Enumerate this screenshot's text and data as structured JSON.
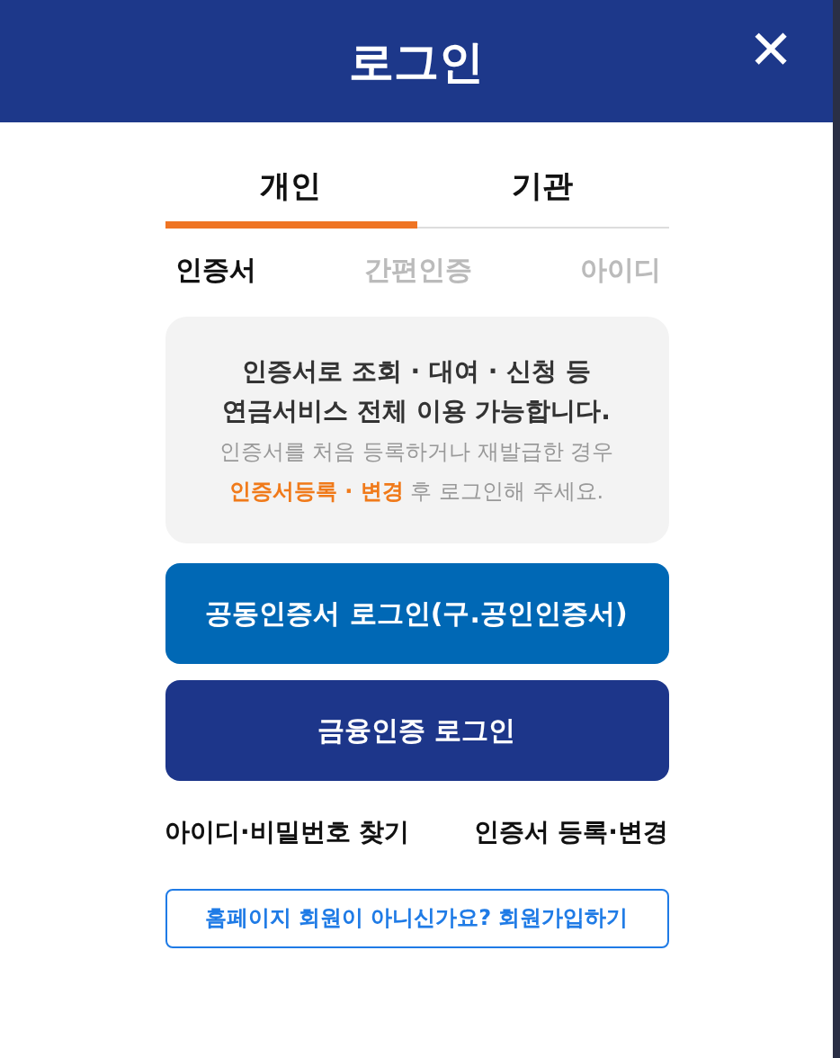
{
  "window": {
    "title": "로그인",
    "close": "✕"
  },
  "tabs": [
    {
      "label": "개인",
      "selected": true
    },
    {
      "label": "기관",
      "selected": false
    }
  ],
  "subtabs": [
    {
      "label": "인증서",
      "selected": true
    },
    {
      "label": "간편인증",
      "selected": false
    },
    {
      "label": "아이디",
      "selected": false
    }
  ],
  "notice": {
    "headline": [
      "인증서로 조회 · 대여 · 신청 등",
      "연금서비스 전체 이용 가능합니다."
    ],
    "note": [
      "인증서를 처음 등록하거나 재발급한 경우",
      "**인증서등록 · 변경** 후 로그인해 주세요."
    ]
  },
  "buttons": [
    {
      "label": "공동인증서 로그인(구.공인인증서)",
      "kind": "primary"
    },
    {
      "label": "금융인증 로그인",
      "kind": "secondary"
    }
  ],
  "links": [
    "아이디·비밀번호 찾기",
    "인증서 등록·변경"
  ],
  "signup": "홈페이지 회원이 아니신가요? 회원가입하기"
}
